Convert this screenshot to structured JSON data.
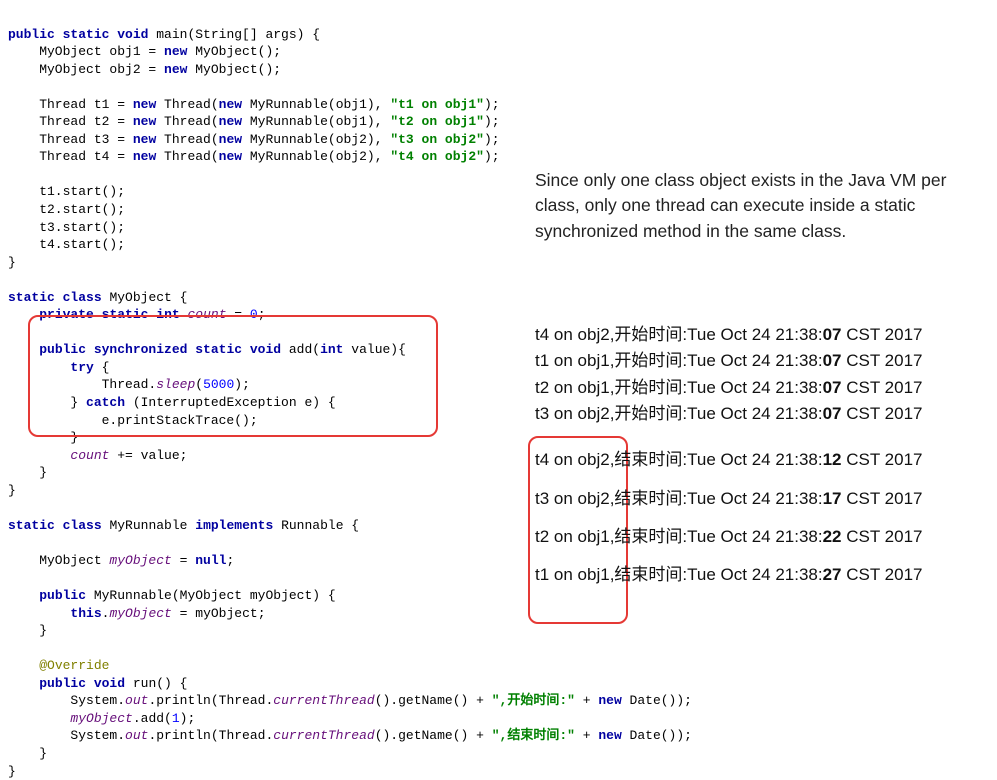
{
  "code": {
    "main_sig_1": "public static void",
    "main_sig_2": " main(String[] args) {",
    "obj1_decl": "    MyObject obj1 = ",
    "obj2_decl": "    MyObject obj2 = ",
    "new_kw": "new",
    "myobj_ctor": " MyObject();",
    "thread_decl_prefix": "    Thread ",
    "t1_name": "t1",
    "t2_name": "t2",
    "t3_name": "t3",
    "t4_name": "t4",
    "thread_new": " Thread(",
    "myrunnable_new": " MyRunnable(obj",
    "obj_idx_1": "1",
    "obj_idx_2": "2",
    "thread_close": "), ",
    "t1_str": "\"t1 on obj1\"",
    "t2_str": "\"t2 on obj1\"",
    "t3_str": "\"t3 on obj2\"",
    "t4_str": "\"t4 on obj2\"",
    "paren_close": ");",
    "t1_start": "    t1.start();",
    "t2_start": "    t2.start();",
    "t3_start": "    t3.start();",
    "t4_start": "    t4.start();",
    "brace_close": "}",
    "static_class_myobj": " MyObject {",
    "static_kw": "static",
    "class_kw": "class",
    "private_kw": "private",
    "int_kw": "int",
    "count_fld": "count",
    "zero": "0",
    "add_sig_1": "public synchronized static void",
    "add_sig_2": " add(",
    "add_sig_3": " value){",
    "try_kw": "try",
    "try_open": " {",
    "sleep_line": "            Thread.",
    "sleep_call": "sleep",
    "sleep_arg": "(",
    "sleep_num": "5000",
    "sleep_close": ");",
    "catch_kw": "catch",
    "catch_line": " (InterruptedException e) {",
    "print_stack": "            e.printStackTrace();",
    "brace_close_8": "        }",
    "count_incr_1": "        ",
    "count_incr_2": " += value;",
    "brace_close_4": "    }",
    "myrunnable_sig": " MyRunnable ",
    "implements_kw": "implements",
    "runnable_cls": " Runnable {",
    "myobj_field_1": "    MyObject ",
    "myobj_field_name": "myObject",
    "null_kw": "null",
    "ctor_sig_1": "public",
    "ctor_sig_2": " MyRunnable(MyObject myObject) {",
    "this_kw": "this",
    "ctor_assign": " = myObject;",
    "override_ann": "@Override",
    "run_sig_1": "public void",
    "run_sig_2": " run() {",
    "println_1a": "        System.",
    "out_fld": "out",
    "println_1b": ".println(Thread.",
    "currentThread_call": "currentThread",
    "println_1c": "().getName() + ",
    "start_time_str": "\",开始时间:\"",
    "println_1d": " + ",
    "date_ctor": " Date());",
    "add_call_1": "        ",
    "add_call_2": ".add(",
    "add_call_num": "1",
    "add_call_3": ");",
    "end_time_str": "\",结束时间:\""
  },
  "explanation": "Since only one class object exists in the Java VM per class, only one thread can execute inside a static synchronized method in the same class.",
  "output": {
    "start": [
      {
        "thread": "t4 on obj2",
        "label": ",开始时间:",
        "prefix": "Tue Oct 24 21:38:",
        "sec": "07",
        "suffix": " CST 2017"
      },
      {
        "thread": "t1 on obj1",
        "label": ",开始时间:",
        "prefix": "Tue Oct 24 21:38:",
        "sec": "07",
        "suffix": " CST 2017"
      },
      {
        "thread": "t2 on obj1",
        "label": ",开始时间:",
        "prefix": "Tue Oct 24 21:38:",
        "sec": "07",
        "suffix": " CST 2017"
      },
      {
        "thread": "t3 on obj2",
        "label": ",开始时间:",
        "prefix": "Tue Oct 24 21:38:",
        "sec": "07",
        "suffix": " CST 2017"
      }
    ],
    "end": [
      {
        "thread": "t4 on obj2",
        "label": ",结束时间:",
        "prefix": "Tue Oct 24 21:38:",
        "sec": "12",
        "suffix": " CST 2017"
      },
      {
        "thread": "t3 on obj2",
        "label": ",结束时间:",
        "prefix": "Tue Oct 24 21:38:",
        "sec": "17",
        "suffix": " CST 2017"
      },
      {
        "thread": "t2 on obj1",
        "label": ",结束时间:",
        "prefix": "Tue Oct 24 21:38:",
        "sec": "22",
        "suffix": " CST 2017"
      },
      {
        "thread": "t1 on obj1",
        "label": ",结束时间:",
        "prefix": "Tue Oct 24 21:38:",
        "sec": "27",
        "suffix": " CST 2017"
      }
    ]
  }
}
